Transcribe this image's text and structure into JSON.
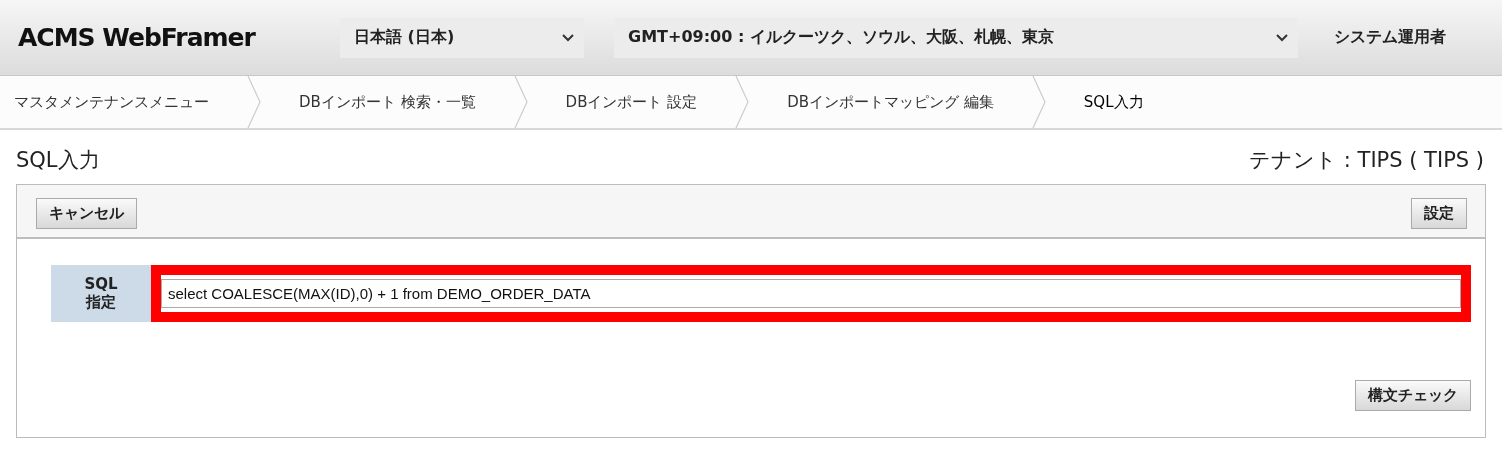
{
  "header": {
    "logo": "ACMS WebFramer",
    "language": "日本語 (日本)",
    "timezone": "GMT+09:00 : イルクーツク、ソウル、大阪、札幌、東京",
    "user": "システム運用者"
  },
  "breadcrumbs": [
    {
      "label": "マスタメンテナンスメニュー",
      "selected": false
    },
    {
      "label": "DBインポート 検索・一覧",
      "selected": false
    },
    {
      "label": "DBインポート 設定",
      "selected": false
    },
    {
      "label": "DBインポートマッピング 編集",
      "selected": false
    },
    {
      "label": "SQL入力",
      "selected": true
    }
  ],
  "page": {
    "title": "SQL入力",
    "tenant": "テナント : TIPS ( TIPS )"
  },
  "toolbar": {
    "left_button": "キャンセル",
    "right_button": "設定"
  },
  "form": {
    "label": "SQL 指定",
    "value": "select COALESCE(MAX(ID),0) + 1 from DEMO_ORDER_DATA",
    "highlighted": true,
    "check_button": "構文チェック"
  }
}
